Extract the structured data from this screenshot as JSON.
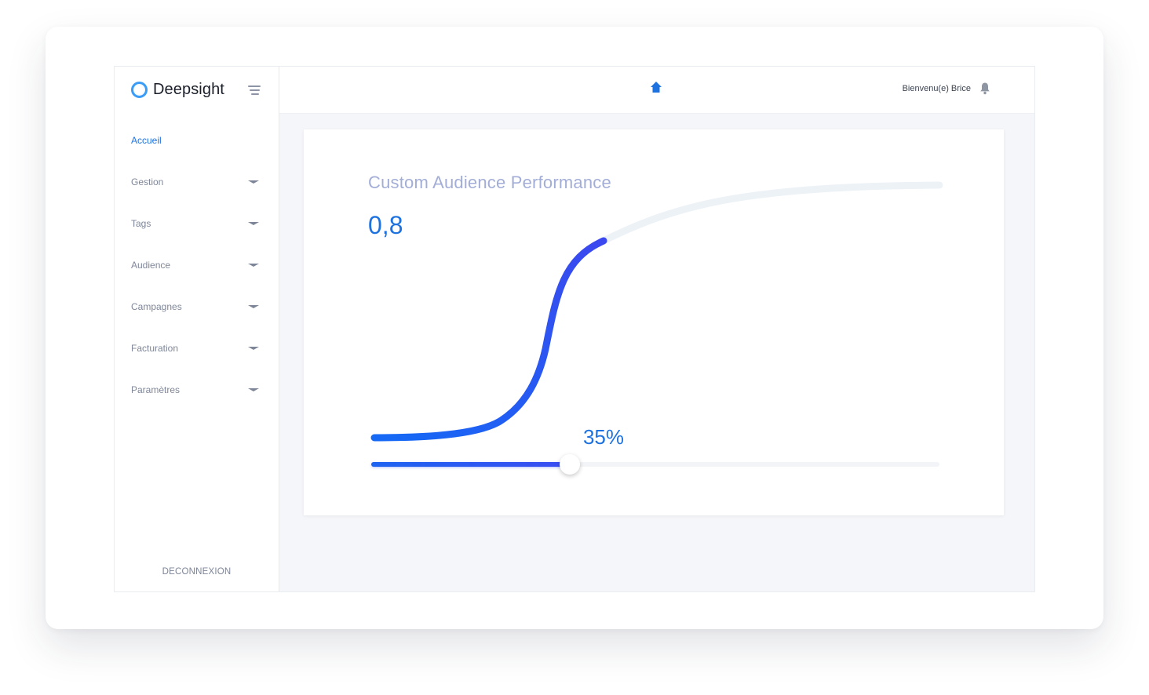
{
  "sidebar": {
    "brand": "Deepsight",
    "items": [
      {
        "label": "Accueil",
        "active": true,
        "expandable": false
      },
      {
        "label": "Gestion",
        "active": false,
        "expandable": true
      },
      {
        "label": "Tags",
        "active": false,
        "expandable": true
      },
      {
        "label": "Audience",
        "active": false,
        "expandable": true
      },
      {
        "label": "Campagnes",
        "active": false,
        "expandable": true
      },
      {
        "label": "Facturation",
        "active": false,
        "expandable": true
      },
      {
        "label": "Paramètres",
        "active": false,
        "expandable": true
      }
    ],
    "logout": "DECONNEXION"
  },
  "header": {
    "home_icon": "home-icon",
    "welcome": "Bienvenu(e) Brice",
    "notification_icon": "bell-icon"
  },
  "card": {
    "title": "Custom Audience Performance",
    "value": "0,8",
    "slider": {
      "percent_label": "35%",
      "value": 0.35
    }
  },
  "colors": {
    "accent": "#1e72e0",
    "curve_start": "#1569f5",
    "curve_end": "#3b48ef",
    "curve_inactive": "#edf2f7",
    "title": "#a3aed8"
  }
}
